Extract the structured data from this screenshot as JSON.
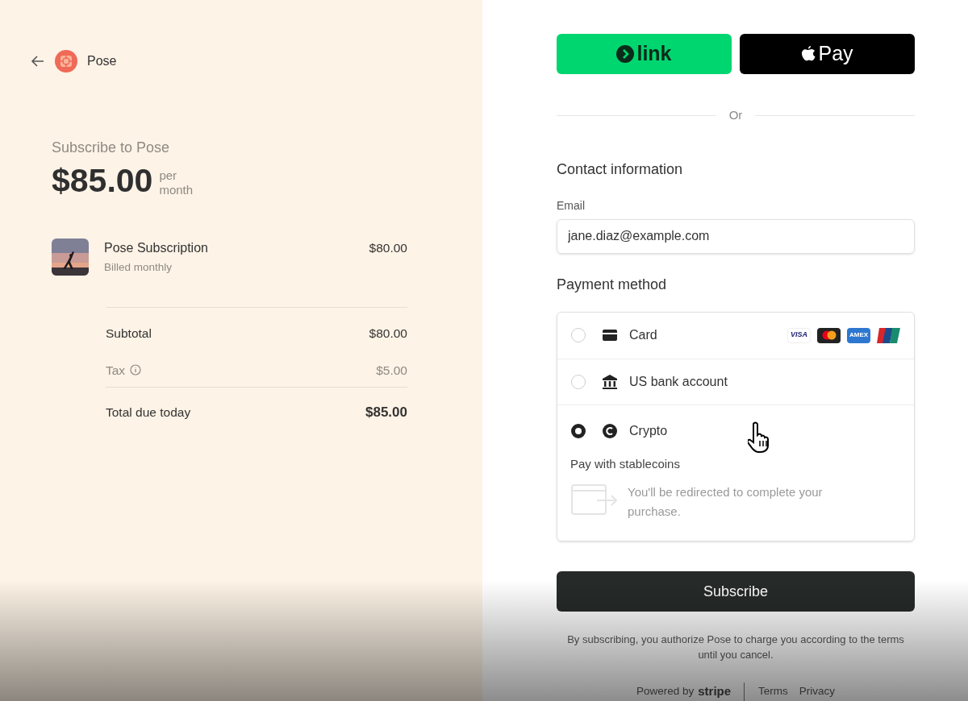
{
  "merchant": {
    "name": "Pose"
  },
  "summary": {
    "title": "Subscribe to Pose",
    "price": "$85.00",
    "period_1": "per",
    "period_2": "month"
  },
  "items": [
    {
      "kind": "picture",
      "name": "Pose Subscription",
      "note": "Billed monthly",
      "amount": "$80.00"
    }
  ],
  "totals": [
    {
      "kind": "subtotal",
      "label": "Subtotal",
      "amount": "$80.00",
      "info": false
    },
    {
      "kind": "tax",
      "label": "Tax",
      "amount": "$5.00",
      "info": true
    },
    {
      "kind": "total",
      "label": "Total due today",
      "amount": "$85.00",
      "info": false
    }
  ],
  "express": [
    {
      "kind": "link",
      "label": "link"
    },
    {
      "kind": "applepay",
      "label": "Pay"
    }
  ],
  "divider": "Or",
  "contact": {
    "heading": "Contact information",
    "email_label": "Email",
    "email": "jane.diaz@example.com"
  },
  "payment": {
    "heading": "Payment method",
    "methods": [
      {
        "kind": "card",
        "label": "Card",
        "selected": false,
        "brands": [
          {
            "kind": "visa",
            "label": "VISA"
          },
          {
            "kind": "mastercard"
          },
          {
            "kind": "amex",
            "label": "AMEX"
          },
          {
            "kind": "unionpay"
          }
        ]
      },
      {
        "kind": "bank",
        "label": "US bank account",
        "selected": false
      },
      {
        "kind": "crypto",
        "label": "Crypto",
        "selected": true,
        "detail_title": "Pay with stablecoins",
        "detail": "You'll be redirected to complete your purchase."
      }
    ]
  },
  "submit": "Subscribe",
  "legal": "By subscribing, you authorize Pose to charge you according to the terms until you cancel.",
  "footer": {
    "powered": "Powered by",
    "brand": "stripe",
    "links": [
      "Terms",
      "Privacy"
    ]
  }
}
